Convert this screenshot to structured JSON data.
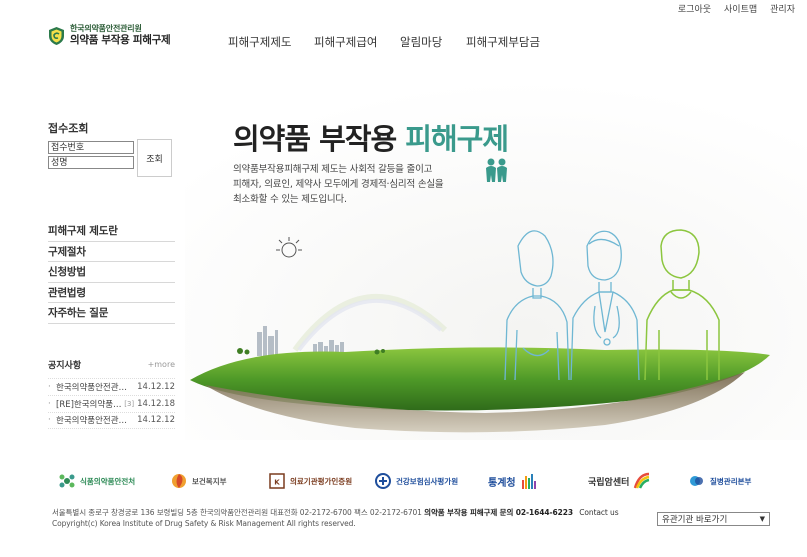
{
  "utility": {
    "logout": "로그아웃",
    "sitemap": "사이트맵",
    "admin": "관리자"
  },
  "logo": {
    "org": "한국의약품안전관리원",
    "service": "의약품 부작용 피해구제"
  },
  "gnb": [
    "피해구제제도",
    "피해구제급여",
    "알림마당",
    "피해구제부담금"
  ],
  "receipt": {
    "title": "접수조회",
    "number_placeholder": "접수번호",
    "name_placeholder": "성명",
    "button": "조회"
  },
  "menu": [
    "피해구제 제도란",
    "구제절차",
    "신청방법",
    "관련법령",
    "자주하는 질문"
  ],
  "notice": {
    "title": "공지사항",
    "more": "+more",
    "items": [
      {
        "title": "한국의약품안전관…",
        "count": "",
        "date": "14.12.12"
      },
      {
        "title": "[RE]한국의약품…",
        "count": "[3]",
        "date": "14.12.18"
      },
      {
        "title": "한국의약품안전관…",
        "count": "",
        "date": "14.12.12"
      }
    ]
  },
  "hero": {
    "title_main": "의약품 부작용 ",
    "title_accent": "피해구제",
    "desc_line1": "의약품부작용피해구제 제도는  사회적 갈등을 줄이고",
    "desc_line2": "피해자, 의료인, 제약사 모두에게 경제적·심리적 손실을",
    "desc_line3": "최소화할 수 있는 제도입니다."
  },
  "partners": [
    {
      "name": "식품의약품안전처",
      "icon": "mfds-icon",
      "color": "#2e8b57"
    },
    {
      "name": "보건복지부",
      "icon": "mohw-icon",
      "color": "#555555"
    },
    {
      "name": "의료기관평가인증원",
      "icon": "koiha-icon",
      "color": "#7a3b1e"
    },
    {
      "name": "건강보험심사평가원",
      "icon": "hira-icon",
      "color": "#1f4e9c"
    },
    {
      "name": "통계청",
      "icon": "kostat-icon",
      "color": "#1f4e9c"
    },
    {
      "name": "국립암센터",
      "icon": "ncc-icon",
      "color": "#333333"
    },
    {
      "name": "질병관리본부",
      "icon": "kcdc-icon",
      "color": "#1f4e9c"
    }
  ],
  "footer": {
    "address": "서울특별시 종로구 창경궁로 136 보령빌딩 5층 한국의약품안전관리원",
    "phone": "대표전화 02-2172-6700",
    "fax": "팩스 02-2172-6701",
    "inquiry": "의약품 부작용 피해구제 문의 02-1644-6223",
    "contact": "Contact us",
    "copyright": "Copyright(c) Korea Institute of Drug Safety & Risk Management  All rights reserved."
  },
  "related_select": "유관기관 바로가기",
  "colors": {
    "accent": "#3a9a8c",
    "grass": "#5aa32a",
    "illustration_line": "#6fb7d3"
  }
}
